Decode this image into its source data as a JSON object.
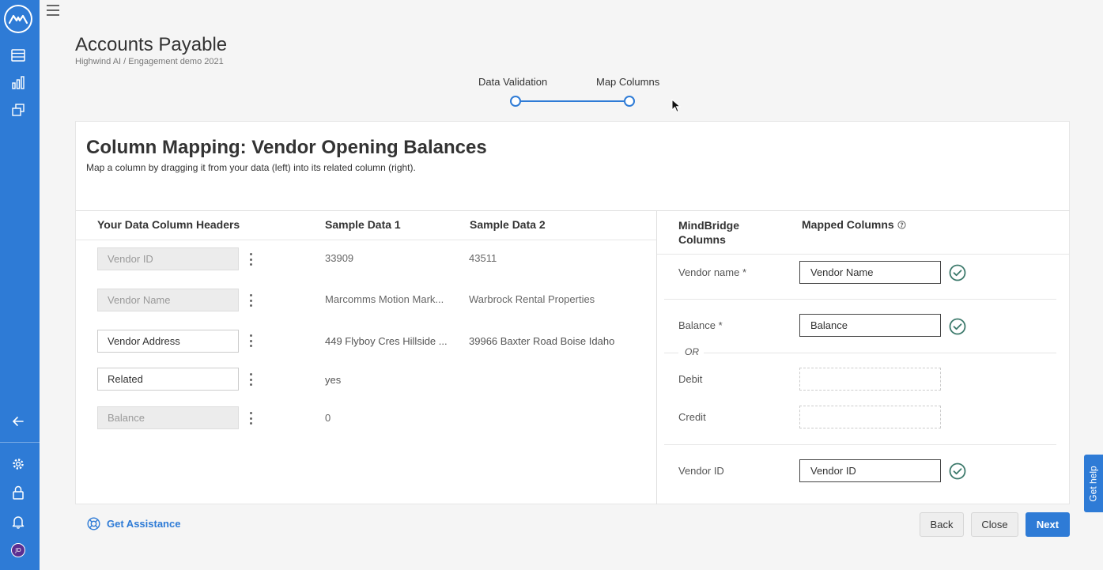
{
  "app": {
    "avatar_initials": "JD",
    "accent_color": "#2e7bd6"
  },
  "sidebar": {
    "icons": [
      "logo-icon",
      "data-table-icon",
      "chart-icon",
      "layers-icon",
      "collapse-arrow-icon",
      "gear-icon",
      "lock-icon",
      "bell-icon"
    ]
  },
  "header": {
    "title": "Accounts Payable",
    "breadcrumb": "Highwind AI / Engagement demo 2021"
  },
  "stepper": {
    "steps": [
      {
        "label": "Data Validation"
      },
      {
        "label": "Map Columns"
      }
    ]
  },
  "card": {
    "title": "Column Mapping: Vendor Opening Balances",
    "subtitle": "Map a column by dragging it from your data (left) into its related column (right)."
  },
  "left": {
    "headers": {
      "your_columns": "Your Data Column Headers",
      "sample1": "Sample Data 1",
      "sample2": "Sample Data 2"
    },
    "rows": [
      {
        "column": "Vendor ID",
        "mapped": true,
        "sample1": "33909",
        "sample2": "43511"
      },
      {
        "column": "Vendor Name",
        "mapped": true,
        "sample1": "Marcomms Motion Mark...",
        "sample2": "Warbrock Rental Properties"
      },
      {
        "column": "Vendor Address",
        "mapped": false,
        "sample1": "449 Flyboy Cres Hillside ...",
        "sample2": "39966 Baxter Road Boise Idaho"
      },
      {
        "column": "Related",
        "mapped": false,
        "sample1": "yes",
        "sample2": ""
      },
      {
        "column": "Balance",
        "mapped": true,
        "sample1": "0",
        "sample2": ""
      }
    ]
  },
  "right": {
    "headers": {
      "mindbridge_line1": "MindBridge",
      "mindbridge_line2": "Columns",
      "mapped": "Mapped Columns"
    },
    "rows": [
      {
        "label": "Vendor name *",
        "value": "Vendor Name",
        "valid": true
      },
      {
        "label": "Balance *",
        "value": "Balance",
        "valid": true
      },
      {
        "label": "Debit",
        "value": "",
        "valid": false
      },
      {
        "label": "Credit",
        "value": "",
        "valid": false
      },
      {
        "label": "Vendor ID",
        "value": "Vendor ID",
        "valid": true
      }
    ],
    "or_text": "OR"
  },
  "footer": {
    "assist_label": "Get Assistance",
    "back": "Back",
    "close": "Close",
    "next": "Next"
  },
  "help_tab": "Get help"
}
